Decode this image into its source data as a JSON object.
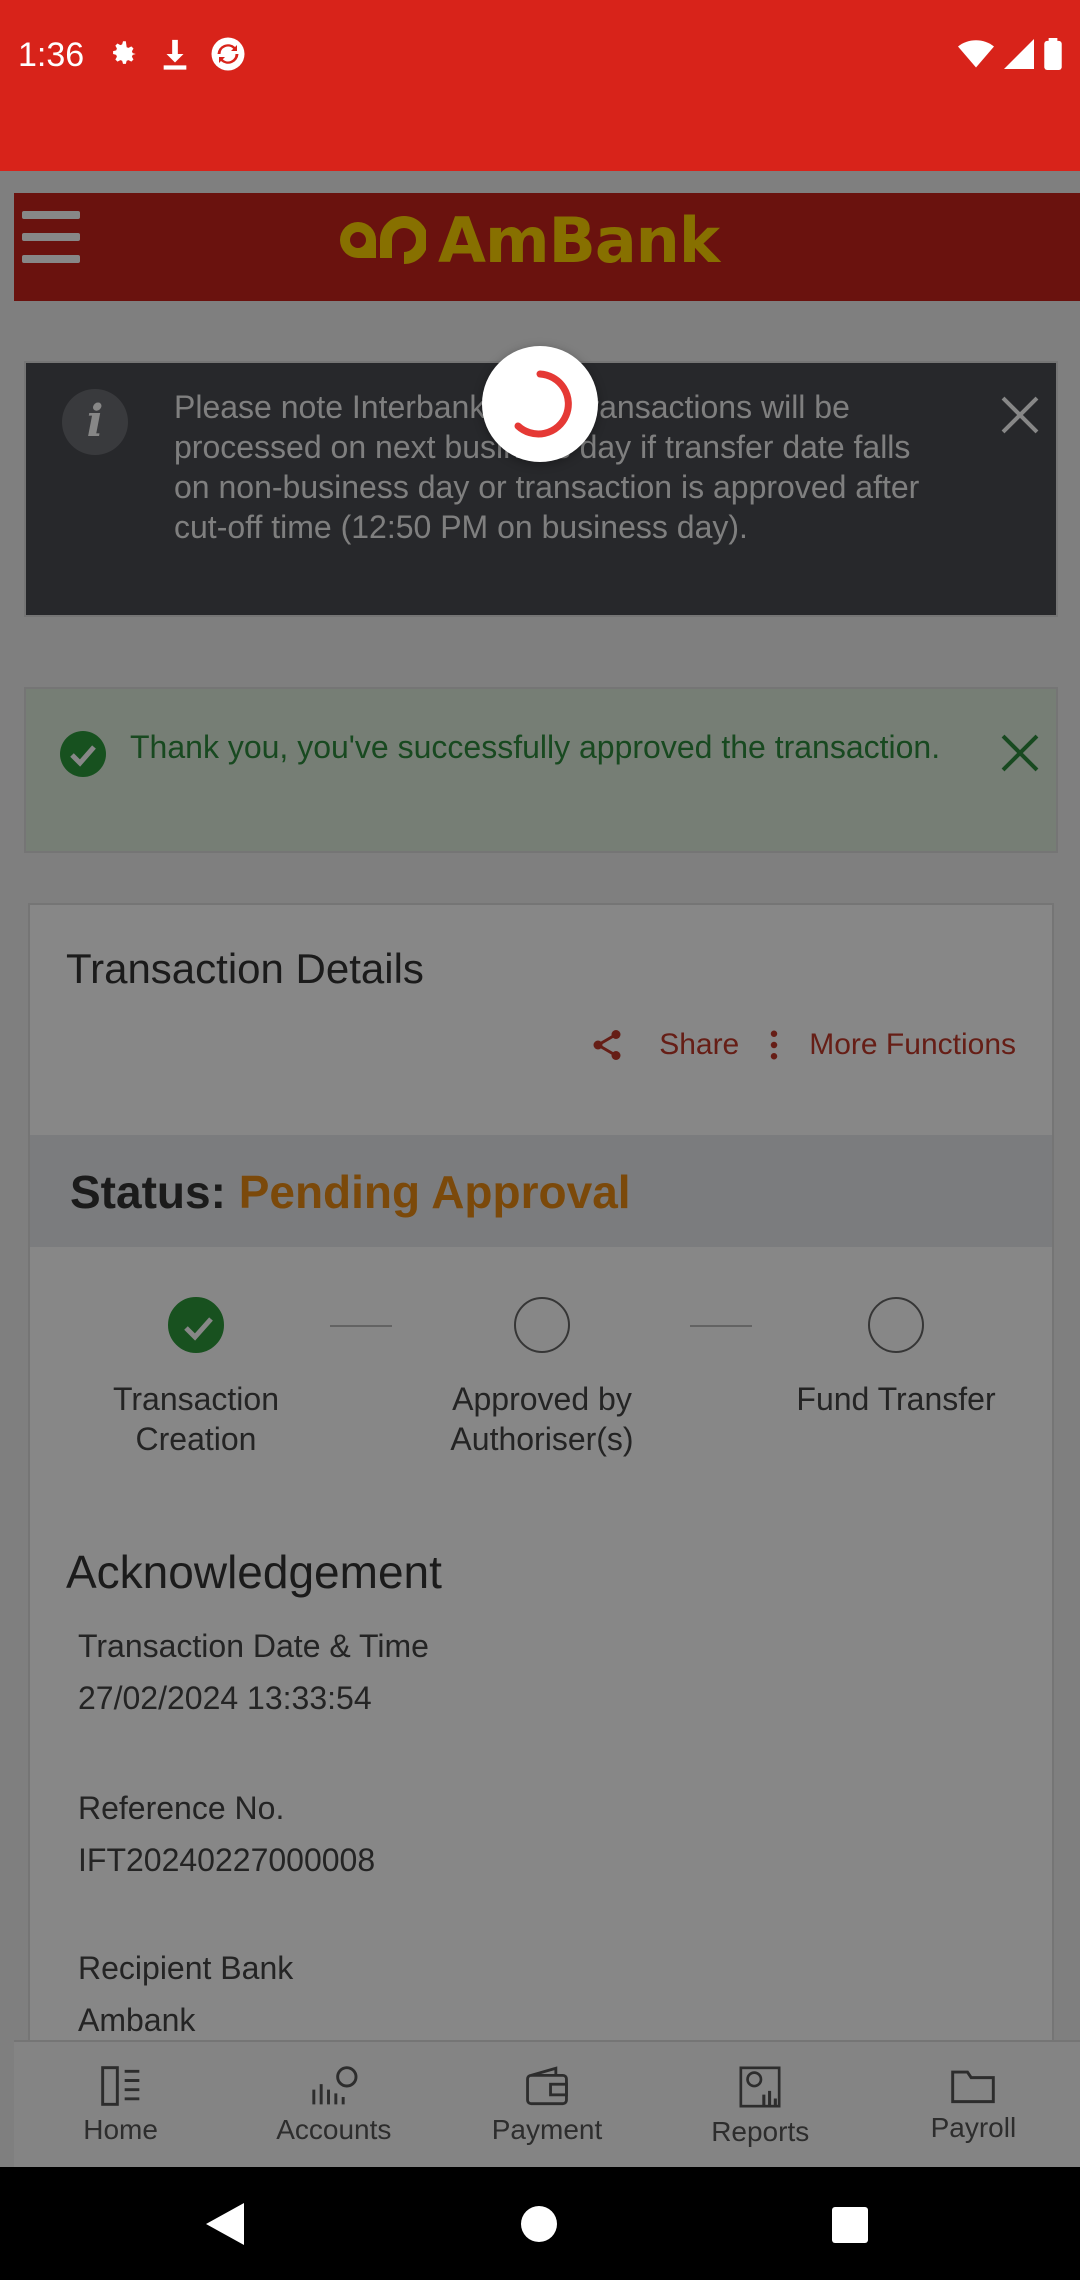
{
  "status_bar": {
    "time": "1:36",
    "icons": [
      "gear-icon",
      "download-icon",
      "sync-icon"
    ],
    "right_icons": [
      "wifi-icon",
      "signal-icon",
      "battery-icon"
    ]
  },
  "header": {
    "brand": "AmBank",
    "brand_color": "#ffd400",
    "bar_color": "#c8231c"
  },
  "info_banner": {
    "icon": "info-icon",
    "text_before": "Please note Interbank",
    "text_after": " (IBG) transactions will be processed on next business day if transfer date falls on non-business day or transaction is approved after cut-off time (12:50 PM on business day)."
  },
  "success_banner": {
    "text": "Thank you, you've successfully approved the transaction."
  },
  "transaction": {
    "title": "Transaction Details",
    "share_label": "Share",
    "more_label": "More Functions",
    "status_label": "Status:",
    "status_value": "Pending Approval",
    "steps": [
      {
        "label_line1": "Transaction",
        "label_line2": "Creation",
        "done": true
      },
      {
        "label_line1": "Approved by",
        "label_line2": "Authoriser(s)",
        "done": false
      },
      {
        "label_line1": "Fund Transfer",
        "label_line2": "",
        "done": false
      }
    ],
    "section_title": "Acknowledgement",
    "fields": [
      {
        "label": "Transaction Date & Time",
        "value": "27/02/2024 13:33:54"
      },
      {
        "label": "Reference No.",
        "value": "IFT20240227000008"
      },
      {
        "label": "Recipient Bank",
        "value": "Ambank"
      }
    ]
  },
  "bottom_nav": [
    {
      "label": "Home",
      "icon": "home-icon"
    },
    {
      "label": "Accounts",
      "icon": "accounts-icon"
    },
    {
      "label": "Payment",
      "icon": "wallet-icon"
    },
    {
      "label": "Reports",
      "icon": "reports-icon"
    },
    {
      "label": "Payroll",
      "icon": "folder-icon"
    }
  ]
}
